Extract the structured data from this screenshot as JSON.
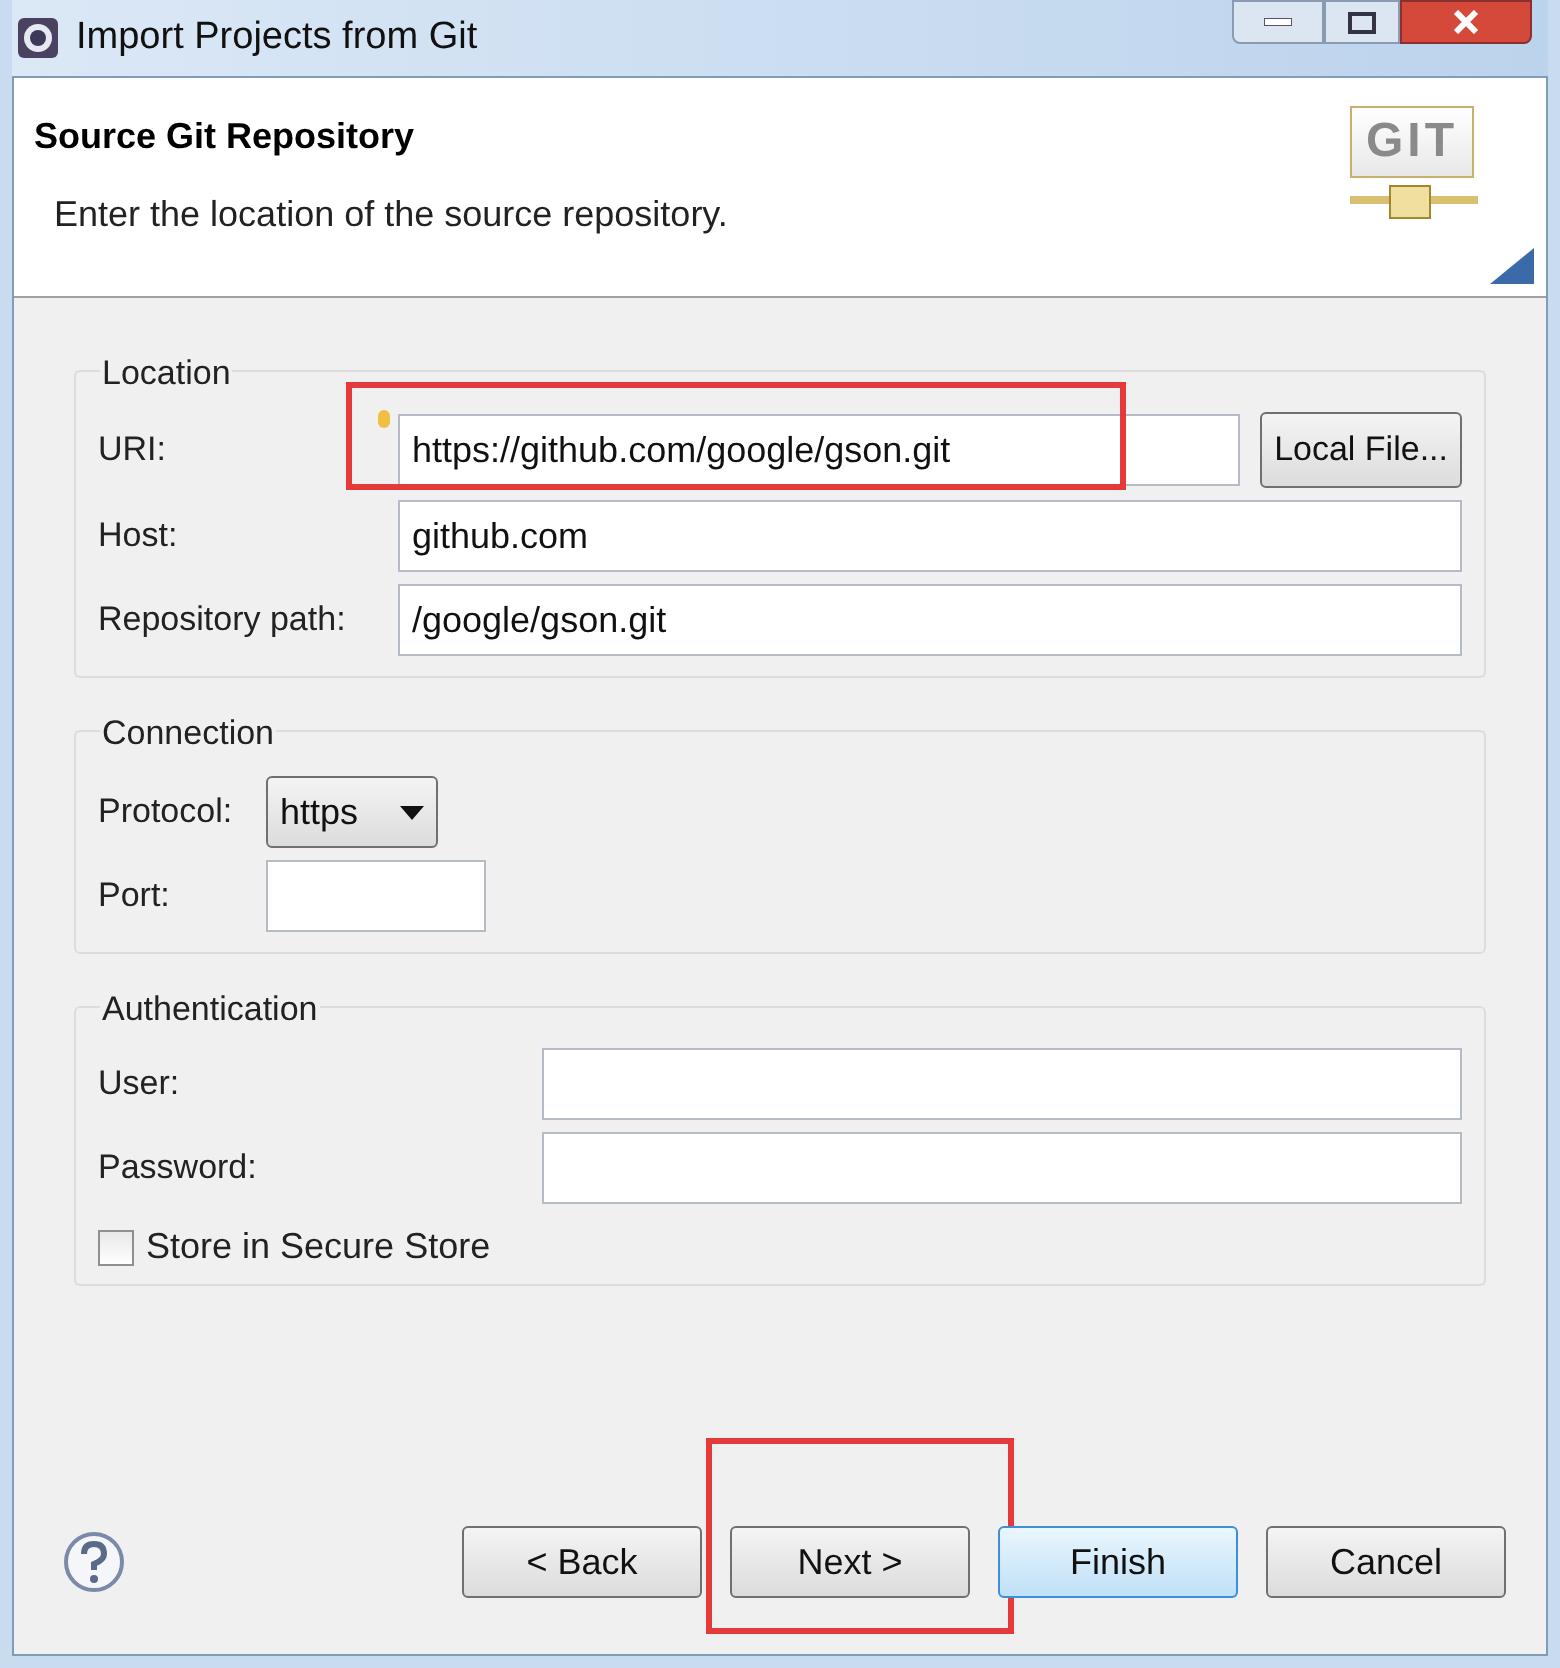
{
  "window": {
    "title": "Import Projects from Git"
  },
  "header": {
    "title": "Source Git Repository",
    "description": "Enter the location of the source repository.",
    "logo": "GIT"
  },
  "location": {
    "legend": "Location",
    "uri": {
      "label": "URI:",
      "value": "https://github.com/google/gson.git",
      "highlighted": true
    },
    "local_file_button": "Local File...",
    "host": {
      "label": "Host:",
      "value": "github.com"
    },
    "repository_path": {
      "label": "Repository path:",
      "value": "/google/gson.git"
    }
  },
  "connection": {
    "legend": "Connection",
    "protocol": {
      "label": "Protocol:",
      "value": "https"
    },
    "port": {
      "label": "Port:"
    }
  },
  "authentication": {
    "legend": "Authentication",
    "user": {
      "label": "User:"
    },
    "password": {
      "label": "Password:"
    },
    "store": {
      "label": "Store in Secure Store",
      "checked": false
    }
  },
  "buttons": [
    {
      "label": "< Back",
      "default": false,
      "highlighted": false
    },
    {
      "label": "Next >",
      "default": false,
      "highlighted": true
    },
    {
      "label": "Finish",
      "default": true,
      "highlighted": false
    },
    {
      "label": "Cancel",
      "default": false,
      "highlighted": false
    }
  ]
}
